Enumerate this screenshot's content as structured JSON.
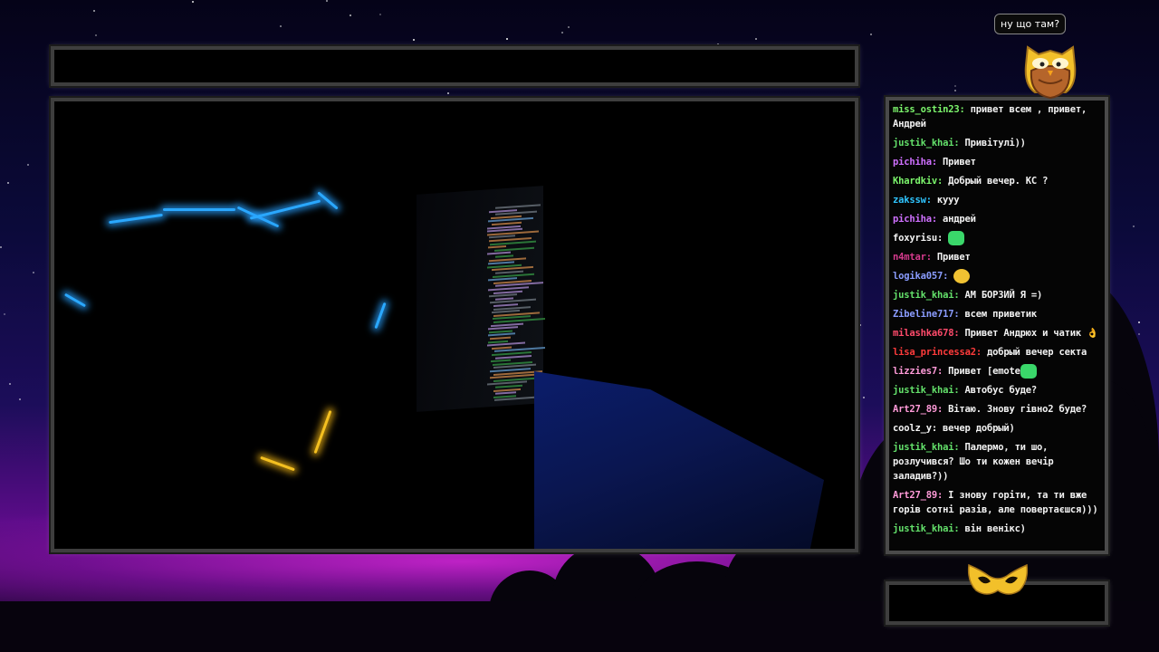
{
  "speech_bubble": "ну що там?",
  "colors": {
    "frame_border": "#3e3e3e",
    "owl_gold": "#f2c02a",
    "owl_brown": "#b5652b",
    "night_sky": "#0b0a3a",
    "horizon_glow": "#c42fd8"
  },
  "icons": [
    "owl-mascot-icon",
    "owl-mask-icon"
  ],
  "chat": {
    "messages": [
      {
        "user": "miss_ostin23:",
        "color": "#7cf56c",
        "text": "привет всем , привет, Андрей"
      },
      {
        "user": "justik_khai:",
        "color": "#63e06a",
        "text": "Привітулі))"
      },
      {
        "user": "pichiha:",
        "color": "#cf70ff",
        "text": "Привет"
      },
      {
        "user": "Khardkiv:",
        "color": "#7cf56c",
        "text": "Добрый вечер. КС ?"
      },
      {
        "user": "zakssw:",
        "color": "#2fc5ff",
        "text": "кууу"
      },
      {
        "user": "pichiha:",
        "color": "#cf70ff",
        "text": "андрей"
      },
      {
        "user": "foxyrisu:",
        "color": "#f4f4f4",
        "text": "",
        "emote": "green"
      },
      {
        "user": "n4mtar:",
        "color": "#d43a8c",
        "text": "Привет"
      },
      {
        "user": "logika057:",
        "color": "#8a9cff",
        "text": "",
        "emote": "duck"
      },
      {
        "user": "justik_khai:",
        "color": "#63e06a",
        "text": "АМ БОРЗИЙ Я =)"
      },
      {
        "user": "Zibeline717:",
        "color": "#8a9cff",
        "text": "всем приветик"
      },
      {
        "user": "milashka678:",
        "color": "#ff4b6b",
        "text": "Привет Андрюх и чатик 👌"
      },
      {
        "user": "lisa_princessa2:",
        "color": "#ff3b3b",
        "text": "добрый вечер секта"
      },
      {
        "user": "lizzies7:",
        "color": "#ff9ad8",
        "text": "Привет [emote",
        "emote": "green"
      },
      {
        "user": "justik_khai:",
        "color": "#63e06a",
        "text": "Автобус буде?"
      },
      {
        "user": "Art27_89:",
        "color": "#ff9ad8",
        "text": "Вітаю. Знову гівно2 буде?"
      },
      {
        "user": "coolz_y:",
        "color": "#f4f4f4",
        "text": "вечер добрый)"
      },
      {
        "user": "justik_khai:",
        "color": "#63e06a",
        "text": "Палермо, ти шо, розлучився? Шо ти кожен вечір заладив?))"
      },
      {
        "user": "Art27_89:",
        "color": "#ff9ad8",
        "text": "І знову горіти, та ти вже горів сотні разів, але повертаєшся)))"
      },
      {
        "user": "justik_khai:",
        "color": "#63e06a",
        "text": "він венікс)"
      }
    ]
  }
}
